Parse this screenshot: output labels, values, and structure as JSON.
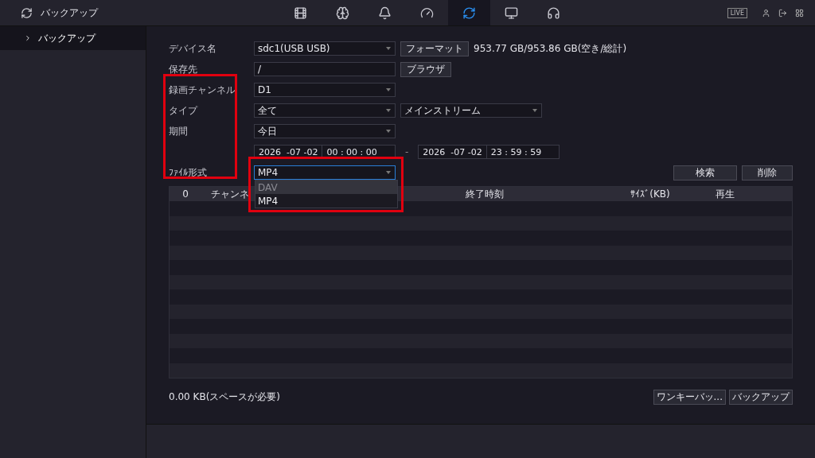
{
  "header": {
    "title": "バックアップ",
    "nav": [
      {
        "kind": "film",
        "selected": false
      },
      {
        "kind": "brain",
        "selected": false
      },
      {
        "kind": "alarm",
        "selected": false
      },
      {
        "kind": "gauge",
        "selected": false
      },
      {
        "kind": "backup",
        "selected": true
      },
      {
        "kind": "monitor",
        "selected": false
      },
      {
        "kind": "headset",
        "selected": false
      }
    ],
    "live": "LIVE"
  },
  "sidebar": {
    "items": [
      {
        "label": "バックアップ",
        "selected": true
      }
    ]
  },
  "form": [
    {
      "label": "デバイス名",
      "fields": [
        {
          "kind": "select",
          "value": "sdc1(USB USB)"
        },
        {
          "kind": "button",
          "label": "フォーマット"
        },
        {
          "kind": "text",
          "text": "953.77 GB/953.86 GB(空き/総計)"
        }
      ]
    },
    {
      "label": "保存先",
      "fields": [
        {
          "kind": "input",
          "value": "/"
        },
        {
          "kind": "button",
          "label": "ブラウザ"
        }
      ]
    },
    {
      "label": "録画チャンネル",
      "fields": [
        {
          "kind": "select",
          "value": "D1"
        }
      ]
    },
    {
      "label": "タイプ",
      "fields": [
        {
          "kind": "select",
          "value": "全て"
        },
        {
          "kind": "select",
          "value": "メインストリーム"
        }
      ]
    },
    {
      "label": "期間",
      "fields": [
        {
          "kind": "select",
          "value": "今日"
        }
      ]
    },
    {
      "fields": [
        {
          "kind": "datetime",
          "date": "2026  -07 -02",
          "time": "00 : 00 : 00"
        },
        {
          "kind": "text",
          "text": "-"
        },
        {
          "kind": "datetime",
          "date": "2026  -07 -02",
          "time": "23 : 59 : 59"
        }
      ]
    },
    {
      "label": "ﾌｧｲﾙ形式",
      "fields": [
        {
          "kind": "select",
          "value": "MP4",
          "open": true,
          "options": [
            {
              "label": "DAV",
              "selected": false
            },
            {
              "label": "MP4",
              "selected": true
            }
          ]
        }
      ]
    }
  ],
  "search_buttons": [
    "検索",
    "削除"
  ],
  "table": {
    "columns": [
      "0",
      "チャンネ",
      "終了時刻",
      "ｻｲｽﾞ(KB)",
      "再生"
    ]
  },
  "footer": {
    "space": "0.00 KB(スペースが必要)",
    "buttons": [
      "ワンキーバッ...",
      "バックアップ"
    ]
  }
}
